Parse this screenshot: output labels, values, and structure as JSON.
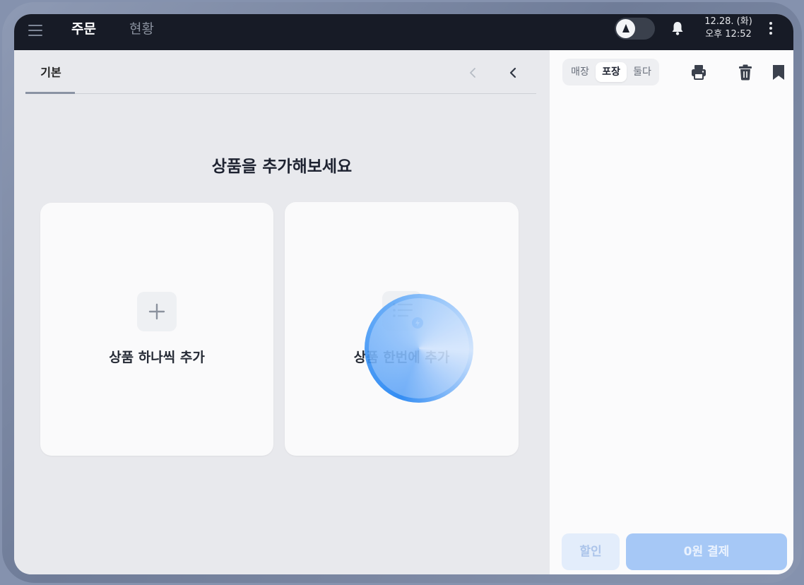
{
  "topbar": {
    "tabs": [
      {
        "label": "주문",
        "active": true
      },
      {
        "label": "현황",
        "active": false
      }
    ],
    "date": "12.28. (화)",
    "time": "오후 12:52"
  },
  "category": {
    "tabs": [
      {
        "label": "기본",
        "active": true
      }
    ]
  },
  "main": {
    "heading": "상품을 추가해보세요",
    "cards": [
      {
        "label": "상품 하나씩 추가",
        "icon": "plus-icon"
      },
      {
        "label": "상품 한번에 추가",
        "icon": "list-lightning-icon"
      }
    ]
  },
  "order": {
    "segments": [
      {
        "label": "매장",
        "active": false
      },
      {
        "label": "포장",
        "active": true
      },
      {
        "label": "둘다",
        "active": false
      }
    ],
    "toolbar_icons": [
      "printer-icon",
      "trash-icon",
      "bookmark-icon"
    ],
    "discount_label": "할인",
    "pay_label": "0원 결제"
  },
  "colors": {
    "topbar_bg": "#171b26",
    "accent_blue": "#1f82f3",
    "pay_button": "#a6c8f6"
  }
}
